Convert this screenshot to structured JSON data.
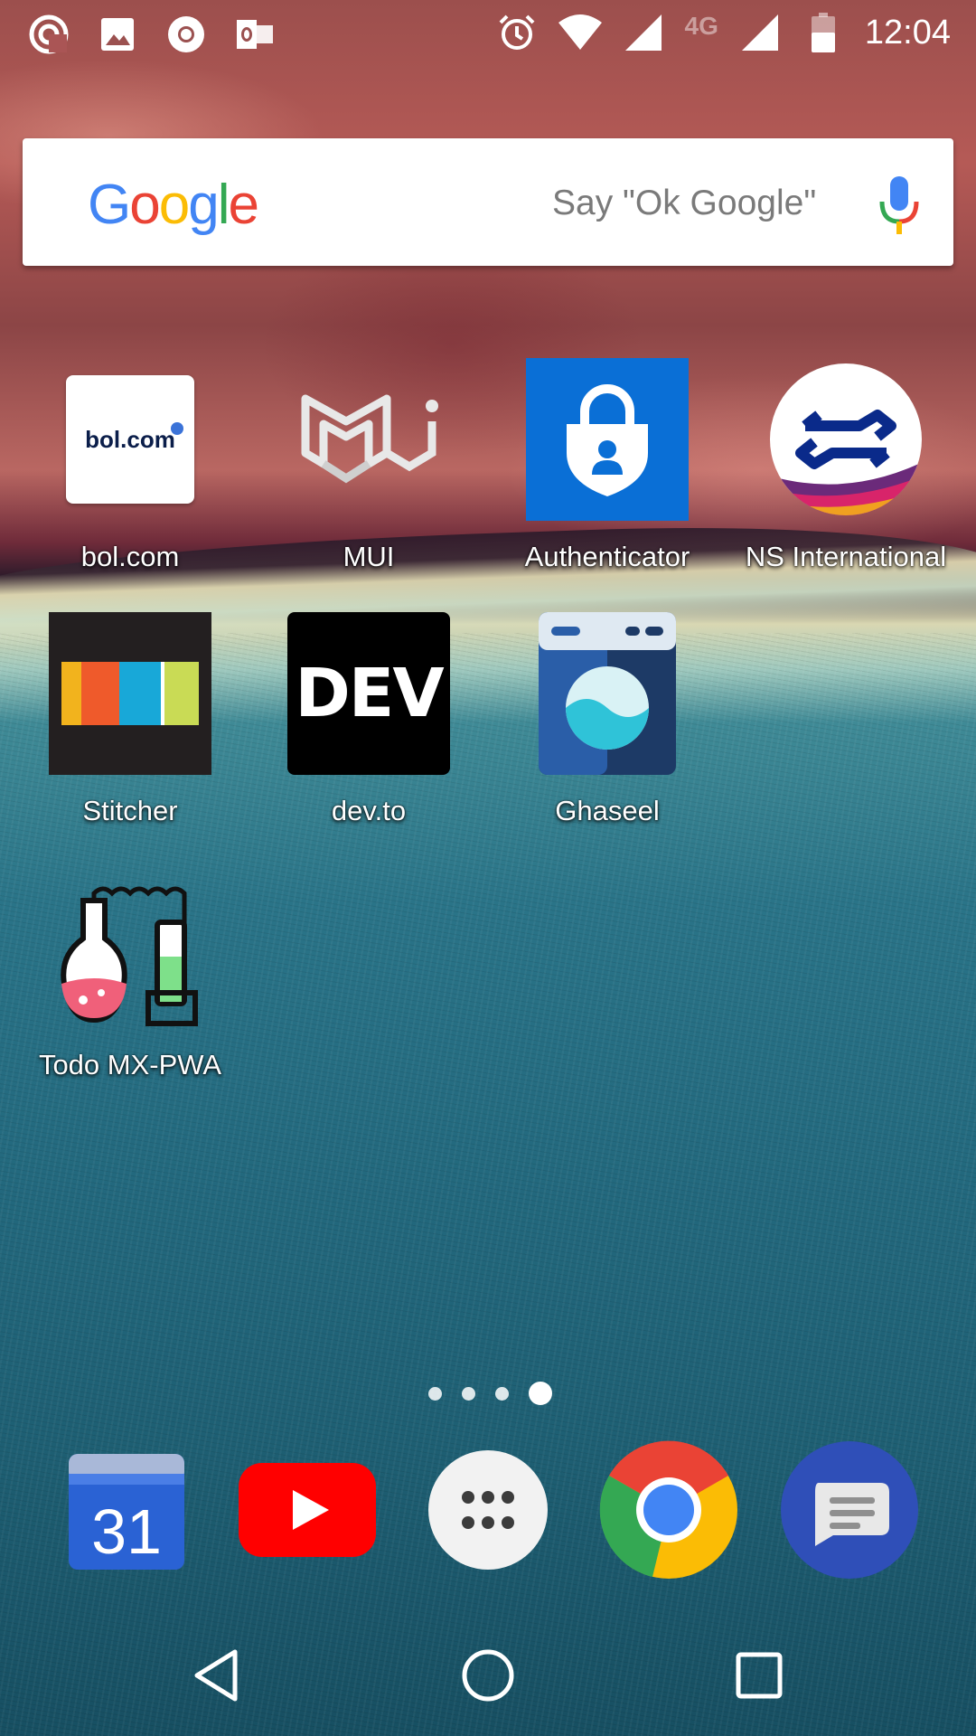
{
  "status_bar": {
    "notification_icons": [
      "pocket-casts-icon",
      "image-icon",
      "chrome-icon",
      "outlook-icon"
    ],
    "system_icons": [
      "alarm-icon",
      "wifi-icon",
      "signal-icon",
      "signal-icon"
    ],
    "network_type": "4G",
    "time": "12:04"
  },
  "search": {
    "logo": "Google",
    "hint": "Say \"Ok Google\"",
    "mic_icon": "mic-icon"
  },
  "apps": [
    {
      "label": "bol.com",
      "icon": "bol-com-icon"
    },
    {
      "label": "MUI",
      "icon": "mui-icon"
    },
    {
      "label": "Authenticator",
      "icon": "authenticator-icon"
    },
    {
      "label": "NS International",
      "icon": "ns-international-icon"
    },
    {
      "label": "Stitcher",
      "icon": "stitcher-icon"
    },
    {
      "label": "dev.to",
      "icon": "dev-to-icon"
    },
    {
      "label": "Ghaseel",
      "icon": "ghaseel-icon"
    },
    {
      "label": "Todo MX-PWA",
      "icon": "todo-mx-pwa-icon"
    }
  ],
  "app_icon_text": {
    "bol": "bol.com",
    "dev": "DEV",
    "calendar_day": "31"
  },
  "page_indicator": {
    "pages": 4,
    "current": 4
  },
  "dock": [
    {
      "name": "calendar",
      "icon": "calendar-icon"
    },
    {
      "name": "youtube",
      "icon": "youtube-icon"
    },
    {
      "name": "app-drawer",
      "icon": "app-drawer-icon"
    },
    {
      "name": "chrome",
      "icon": "chrome-icon"
    },
    {
      "name": "messages",
      "icon": "messages-icon"
    }
  ],
  "nav": [
    "back-icon",
    "home-icon",
    "recents-icon"
  ],
  "colors": {
    "google_blue": "#4285F4",
    "google_red": "#EA4335",
    "google_yellow": "#FBBC05",
    "google_green": "#34A853",
    "youtube_red": "#FF0000",
    "authenticator_blue": "#0A6FD6"
  }
}
